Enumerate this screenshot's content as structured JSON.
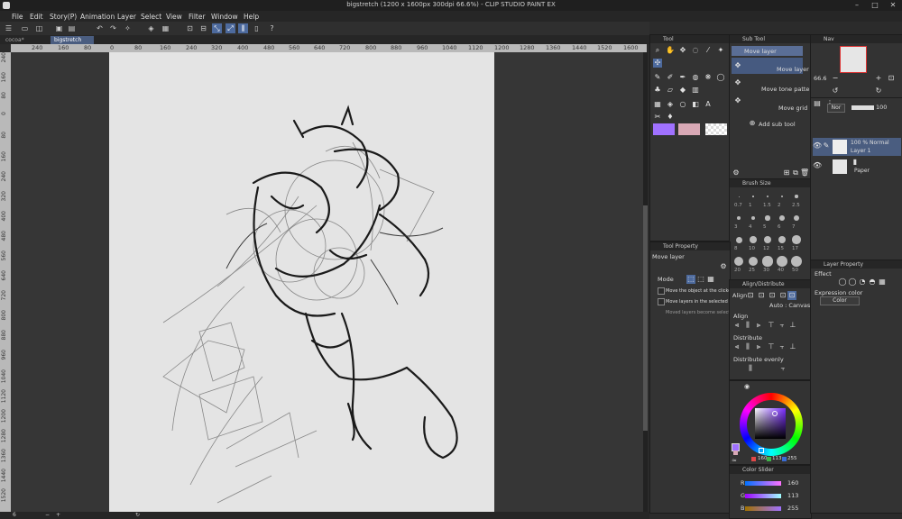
{
  "window": {
    "title": "bigstretch (1200 x 1600px 300dpi 66.6%) - CLIP STUDIO PAINT EX"
  },
  "menu": [
    "File",
    "Edit",
    "Story(P)",
    "Animation",
    "Layer",
    "Select",
    "View",
    "Filter",
    "Window",
    "Help"
  ],
  "tabs": [
    "cocoa*",
    "bigstretch"
  ],
  "ruler_h": [
    "240",
    "160",
    "80",
    "0",
    "80",
    "160",
    "240",
    "320",
    "400",
    "480",
    "560",
    "640",
    "720",
    "800",
    "880",
    "960",
    "1040",
    "1120",
    "1200",
    "1280",
    "1360",
    "1440",
    "1520",
    "1600"
  ],
  "ruler_v": [
    "240",
    "160",
    "80",
    "0",
    "80",
    "160",
    "240",
    "320",
    "400",
    "480",
    "560",
    "640",
    "720",
    "800",
    "880",
    "960",
    "1040",
    "1120",
    "1200",
    "1280",
    "1360",
    "1440",
    "1520"
  ],
  "status": {
    "zoom": "6"
  },
  "tool_panel": {
    "title": "Tool"
  },
  "subtool_panel": {
    "title": "Sub Tool",
    "items": [
      "Move layer",
      "Move layer",
      "Move tone pattern",
      "Move grid"
    ],
    "add_label": "Add sub tool"
  },
  "brush_size": {
    "title": "Brush Size",
    "sizes": [
      "0.7",
      "1",
      "1.5",
      "2",
      "2.5",
      "3",
      "4",
      "5",
      "6",
      "7",
      "8",
      "10",
      "12",
      "15",
      "17",
      "20",
      "25",
      "30",
      "40",
      "50"
    ]
  },
  "tool_property": {
    "title": "Tool Property",
    "tool_name": "Move layer",
    "mode_label": "Mode",
    "opt1": "Move the object at the clicked",
    "opt2": "Move layers in the selected area",
    "opt3": "Moved layers become selected"
  },
  "align_panel": {
    "title": "Align/Distribute",
    "align_prefix": "Align",
    "auto_label": "Auto : Canvas",
    "align_label": "Align",
    "distribute_label": "Distribute",
    "distribute_evenly_label": "Distribute evenly"
  },
  "color_wheel": {
    "r": "160",
    "g": "113",
    "b": "255",
    "main_color": "#a071ff"
  },
  "color_slider": {
    "title": "Color Slider",
    "r_label": "R",
    "r_value": "160",
    "g_label": "G",
    "g_value": "113",
    "b_label": "B",
    "b_value": "255"
  },
  "navigator": {
    "title": "Nav",
    "zoom": "66.6"
  },
  "layer_panel": {
    "blend": "Nor",
    "opacity": "100",
    "layers": [
      {
        "top": "100 % Normal",
        "name": "Layer 1"
      },
      {
        "top": "",
        "name": "Paper"
      }
    ]
  },
  "layer_property": {
    "title": "Layer Property",
    "effect_label": "Effect",
    "expression_color_label": "Expression color",
    "color_option": "Color"
  },
  "colors": {
    "accent": "#4d6a9d",
    "purple": "#a071ff",
    "pink": "#d8a8b5",
    "bg_dark": "#2b2b2b"
  }
}
